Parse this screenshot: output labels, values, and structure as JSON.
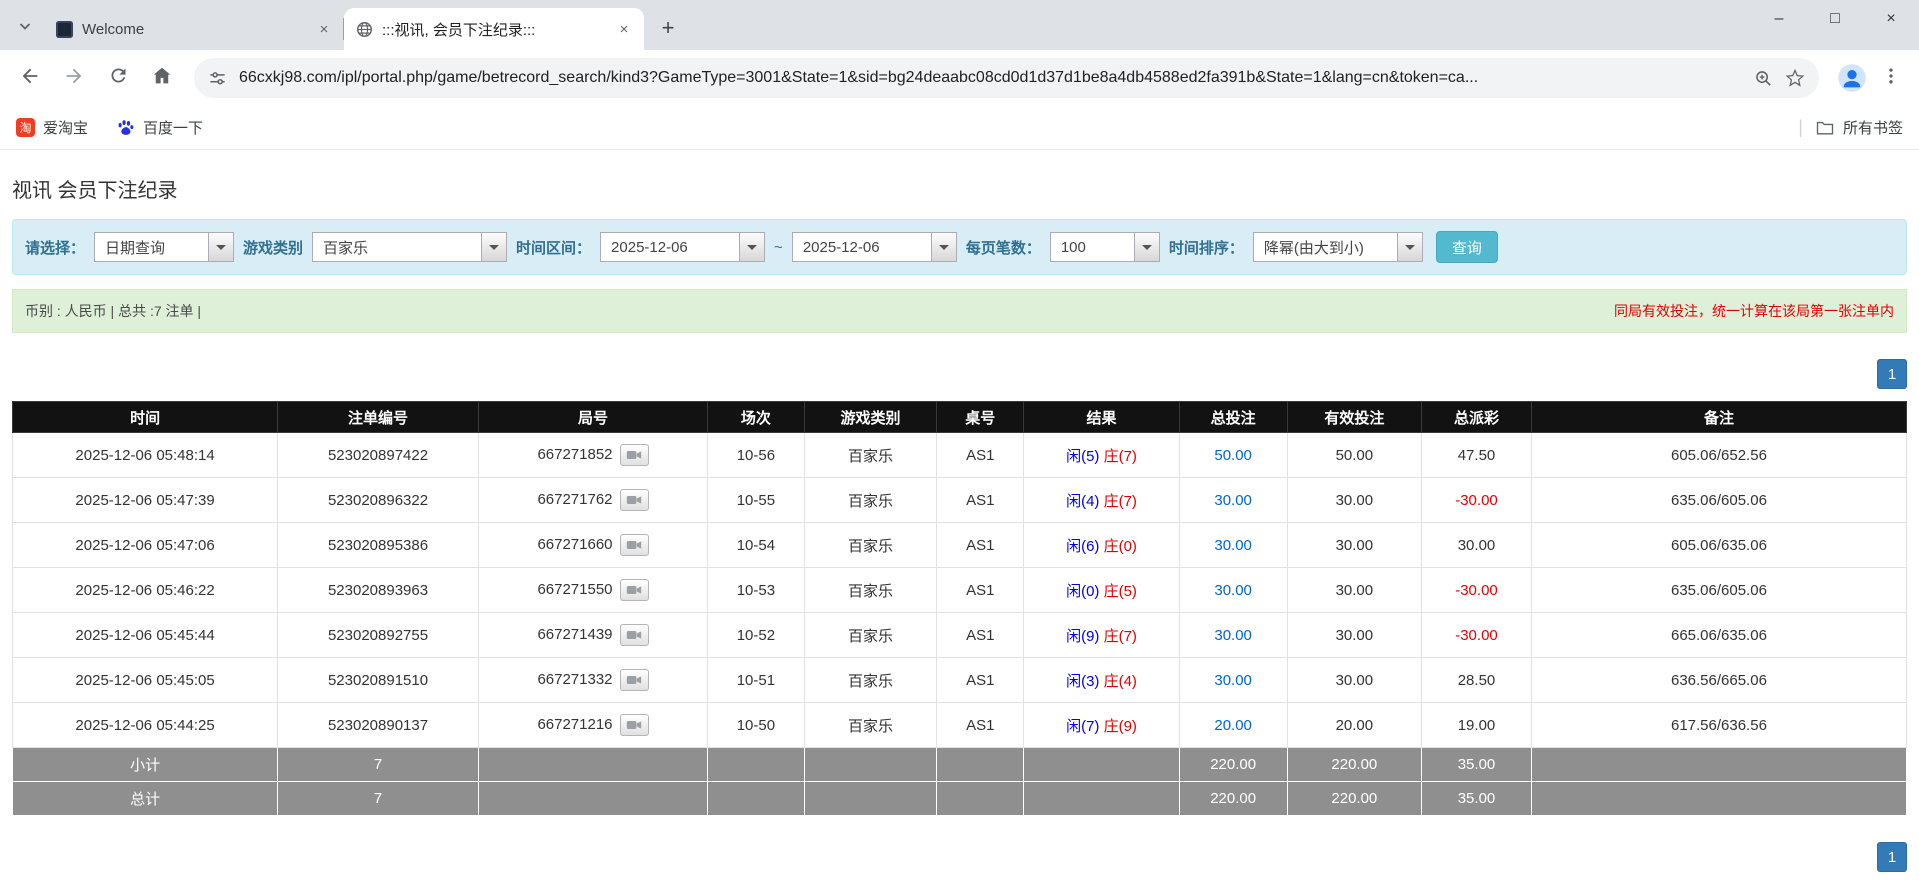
{
  "browser": {
    "tabs": [
      {
        "title": "Welcome"
      },
      {
        "title": ":::视讯, 会员下注纪录:::"
      }
    ],
    "url": "66cxkj98.com/ipl/portal.php/game/betrecord_search/kind3?GameType=3001&State=1&sid=bg24deaabc08cd0d1d37d1be8a4db4588ed2fa391b&State=1&lang=cn&token=ca...",
    "bookmarks": [
      {
        "label": "爱淘宝"
      },
      {
        "label": "百度一下"
      }
    ],
    "all_bookmarks_label": "所有书签",
    "icons": {
      "minimize": "–",
      "maximize": "□",
      "close": "×",
      "tab_close": "×",
      "new_tab": "+",
      "taobao_glyph": "淘"
    }
  },
  "page": {
    "title": "视讯 会员下注纪录",
    "filter": {
      "select_label": "请选择：",
      "select_value": "日期查询",
      "game_type_label": "游戏类别",
      "game_type_value": "百家乐",
      "date_range_label": "时间区间：",
      "date_from": "2025-12-06",
      "date_separator": "~",
      "date_to": "2025-12-06",
      "per_page_label": "每页笔数：",
      "per_page_value": "100",
      "sort_label": "时间排序：",
      "sort_value": "降幂(由大到小)",
      "search_button": "查询"
    },
    "summary": {
      "info": "币别 : 人民币 | 总共 :7 注单 |",
      "notice": "同局有效投注，统一计算在该局第一张注单内"
    },
    "pagination": {
      "page": "1"
    }
  },
  "table": {
    "headers": [
      "时间",
      "注单编号",
      "局号",
      "场次",
      "游戏类别",
      "桌号",
      "结果",
      "总投注",
      "有效投注",
      "总派彩",
      "备注"
    ],
    "rows": [
      {
        "time": "2025-12-06 05:48:14",
        "bet_id": "523020897422",
        "round_no": "667271852",
        "session": "10-56",
        "game": "百家乐",
        "table_no": "AS1",
        "result_player": "闲(5)",
        "result_banker": "庄(7)",
        "total_bet": "50.00",
        "valid_bet": "50.00",
        "payout": "47.50",
        "note": "605.06/652.56"
      },
      {
        "time": "2025-12-06 05:47:39",
        "bet_id": "523020896322",
        "round_no": "667271762",
        "session": "10-55",
        "game": "百家乐",
        "table_no": "AS1",
        "result_player": "闲(4)",
        "result_banker": "庄(7)",
        "total_bet": "30.00",
        "valid_bet": "30.00",
        "payout": "-30.00",
        "note": "635.06/605.06"
      },
      {
        "time": "2025-12-06 05:47:06",
        "bet_id": "523020895386",
        "round_no": "667271660",
        "session": "10-54",
        "game": "百家乐",
        "table_no": "AS1",
        "result_player": "闲(6)",
        "result_banker": "庄(0)",
        "total_bet": "30.00",
        "valid_bet": "30.00",
        "payout": "30.00",
        "note": "605.06/635.06"
      },
      {
        "time": "2025-12-06 05:46:22",
        "bet_id": "523020893963",
        "round_no": "667271550",
        "session": "10-53",
        "game": "百家乐",
        "table_no": "AS1",
        "result_player": "闲(0)",
        "result_banker": "庄(5)",
        "total_bet": "30.00",
        "valid_bet": "30.00",
        "payout": "-30.00",
        "note": "635.06/605.06"
      },
      {
        "time": "2025-12-06 05:45:44",
        "bet_id": "523020892755",
        "round_no": "667271439",
        "session": "10-52",
        "game": "百家乐",
        "table_no": "AS1",
        "result_player": "闲(9)",
        "result_banker": "庄(7)",
        "total_bet": "30.00",
        "valid_bet": "30.00",
        "payout": "-30.00",
        "note": "665.06/635.06"
      },
      {
        "time": "2025-12-06 05:45:05",
        "bet_id": "523020891510",
        "round_no": "667271332",
        "session": "10-51",
        "game": "百家乐",
        "table_no": "AS1",
        "result_player": "闲(3)",
        "result_banker": "庄(4)",
        "total_bet": "30.00",
        "valid_bet": "30.00",
        "payout": "28.50",
        "note": "636.56/665.06"
      },
      {
        "time": "2025-12-06 05:44:25",
        "bet_id": "523020890137",
        "round_no": "667271216",
        "session": "10-50",
        "game": "百家乐",
        "table_no": "AS1",
        "result_player": "闲(7)",
        "result_banker": "庄(9)",
        "total_bet": "20.00",
        "valid_bet": "20.00",
        "payout": "19.00",
        "note": "617.56/636.56"
      }
    ],
    "subtotal": {
      "label": "小计",
      "count": "7",
      "total_bet": "220.00",
      "valid_bet": "220.00",
      "payout": "35.00"
    },
    "total": {
      "label": "总计",
      "count": "7",
      "total_bet": "220.00",
      "valid_bet": "220.00",
      "payout": "35.00"
    }
  }
}
